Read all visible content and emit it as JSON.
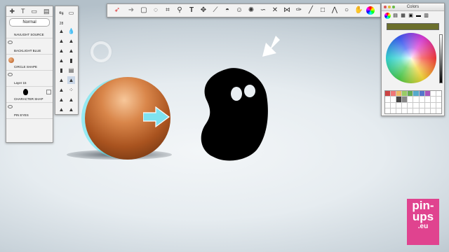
{
  "layers_panel": {
    "blend_mode": "Normal",
    "layers": [
      {
        "name": "NAVLIGHT SOURCE"
      },
      {
        "name": "BACKLIGHT BLUE"
      },
      {
        "name": "CIRCLE SHAPE"
      },
      {
        "name": "Layer 15"
      },
      {
        "name": "CHARACTER SHAP"
      },
      {
        "name": "PIN EYES"
      }
    ]
  },
  "colors_panel": {
    "title": "Colors",
    "current_color": "#6b6f2c"
  },
  "tools_panel": {
    "brush_size": "28"
  },
  "canvas": {
    "sphere_color": "#d9864a",
    "arrow_color": "#7fe2f0",
    "ghost_color": "#000000"
  },
  "watermark": {
    "line1": "pin-",
    "line2": "ups",
    "line3": ".eu",
    "color": "#e0438f"
  }
}
